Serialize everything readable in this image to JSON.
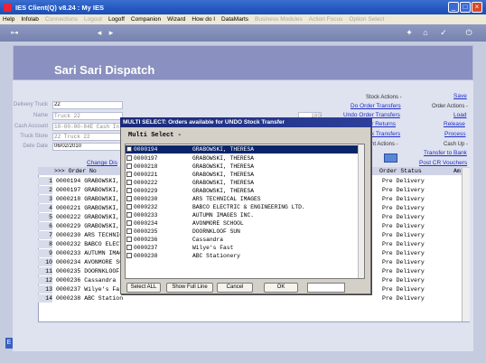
{
  "window": {
    "title": "IES Client(Q) v8.24 : My IES"
  },
  "menu": [
    {
      "label": "Help",
      "enabled": true
    },
    {
      "label": "Infolab",
      "enabled": true
    },
    {
      "label": "Connections",
      "enabled": false
    },
    {
      "label": "Logout",
      "enabled": false
    },
    {
      "label": "Logoff",
      "enabled": true
    },
    {
      "label": "Companion",
      "enabled": true
    },
    {
      "label": "Wizard",
      "enabled": true
    },
    {
      "label": "How do I",
      "enabled": true
    },
    {
      "label": "DataMarts",
      "enabled": true
    },
    {
      "label": "Business Modules",
      "enabled": false
    },
    {
      "label": "Action Focus",
      "enabled": false
    },
    {
      "label": "Option Select",
      "enabled": false
    }
  ],
  "screen": {
    "title": "Sari Sari Dispatch"
  },
  "form": {
    "delivery_truck_label": "Delivery Truck",
    "delivery_truck_value": "22",
    "name_label": "Name",
    "name_value": "Truck 22",
    "cash_account_label": "Cash Account",
    "cash_account_value": "18-00-00-84E Cash In",
    "truck_store_label": "Truck Store",
    "truck_store_value": "22 Truck 22",
    "deliv_date_label": "Deliv Date",
    "deliv_date_value": "06/02/2010",
    "amount_value": "180",
    "change_dis_link": "Change Dis"
  },
  "right_panel": {
    "stock_actions_label": "Stock Actions -",
    "do_order_transfers": "Do Order Transfers",
    "undo_order_transfers": "Undo Order Transfers",
    "order_returns": "der Returns",
    "k_transfers": "k Transfers",
    "order_actions_label": "Order Actions -",
    "save": "Save",
    "load": "Load",
    "release": "Release",
    "process": "Process",
    "nt_actions_label": "nt Actions -",
    "cash_up_label": "Cash Up -",
    "transfer_to_bank": "Transfer to Bank",
    "post_cr_vouchers": "Post CR Vouchers"
  },
  "grid": {
    "header_order": ">>> Order No",
    "header_status": "Order Status",
    "header_am": "Am",
    "rows": [
      {
        "n": "1",
        "text": "0000194 GRABOWSKI,",
        "status": "Pre Delivery"
      },
      {
        "n": "2",
        "text": "0000197 GRABOWSKI,",
        "status": "Pre Delivery"
      },
      {
        "n": "3",
        "text": "0000218 GRABOWSKI,",
        "status": "Pre Delivery"
      },
      {
        "n": "4",
        "text": "0000221 GRABOWSKI,",
        "status": "Pre Delivery"
      },
      {
        "n": "5",
        "text": "0000222 GRABOWSKI,",
        "status": "Pre Delivery"
      },
      {
        "n": "6",
        "text": "0000229 GRABOWSKI,",
        "status": "Pre Delivery"
      },
      {
        "n": "7",
        "text": "0000230 ARS TECHNIC",
        "status": "Pre Delivery"
      },
      {
        "n": "8",
        "text": "0000232 BABCO ELECT",
        "status": "Pre Delivery"
      },
      {
        "n": "9",
        "text": "0000233 AUTUMN IMAG",
        "status": "Pre Delivery"
      },
      {
        "n": "10",
        "text": "0000234 AVONMORE SC",
        "status": "Pre Delivery"
      },
      {
        "n": "11",
        "text": "0000235 DOORNKLOOF",
        "status": "Pre Delivery"
      },
      {
        "n": "12",
        "text": "0000236 Cassandra",
        "status": "Pre Delivery"
      },
      {
        "n": "13",
        "text": "0000237 Wilye's Fas",
        "status": "Pre Delivery"
      },
      {
        "n": "14",
        "text": "0000238 ABC Station",
        "status": "Pre Delivery"
      }
    ]
  },
  "dialog": {
    "title": "MULTI SELECT: Orders available for UNDO Stock Transfer",
    "subtitle": "Multi Select -",
    "items": [
      {
        "code": "0000194",
        "name": "GRABOWSKI, THERESA",
        "selected": true
      },
      {
        "code": "0000197",
        "name": "GRABOWSKI, THERESA",
        "selected": false
      },
      {
        "code": "0000218",
        "name": "GRABOWSKI, THERESA",
        "selected": false
      },
      {
        "code": "0000221",
        "name": "GRABOWSKI, THERESA",
        "selected": false
      },
      {
        "code": "0000222",
        "name": "GRABOWSKI, THERESA",
        "selected": false
      },
      {
        "code": "0000229",
        "name": "GRABOWSKI, THERESA",
        "selected": false
      },
      {
        "code": "0000230",
        "name": "ARS TECHNICAL IMAGES",
        "selected": false
      },
      {
        "code": "0000232",
        "name": "BABCO ELECTRIC & ENGINEERING LTD.",
        "selected": false
      },
      {
        "code": "0000233",
        "name": "AUTUMN IMAGES INC.",
        "selected": false
      },
      {
        "code": "0000234",
        "name": "AVONMORE SCHOOL",
        "selected": false
      },
      {
        "code": "0000235",
        "name": "DOORNKLOOF SUN",
        "selected": false
      },
      {
        "code": "0000236",
        "name": "Cassandra",
        "selected": false
      },
      {
        "code": "0000237",
        "name": "Wilye's Fast",
        "selected": false
      },
      {
        "code": "0000238",
        "name": "ABC Stationery",
        "selected": false
      }
    ],
    "buttons": {
      "select_all": "Select ALL",
      "show_full_line": "Show Full Line",
      "cancel": "Cancel",
      "ok": "OK"
    }
  },
  "colors": {
    "titlebar": "#2458c0",
    "banner": "#8a90bf",
    "dialog_title": "#1a2a78",
    "link": "#1c2fc8",
    "selection": "#0a246a"
  }
}
